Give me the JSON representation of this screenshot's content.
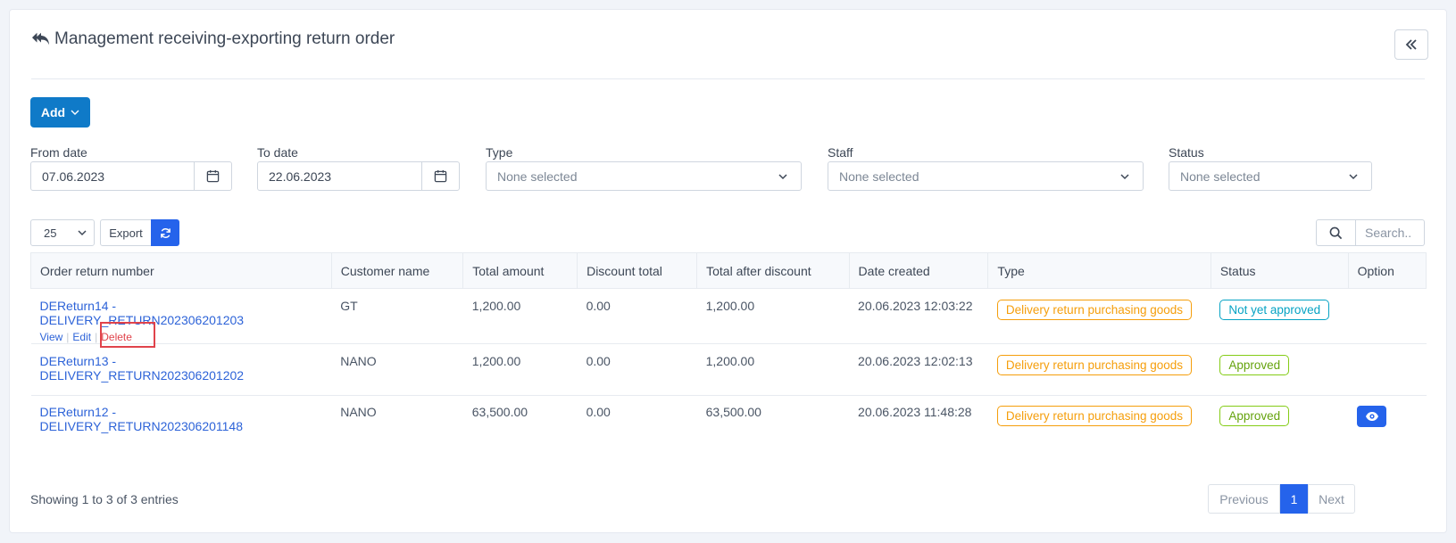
{
  "header": {
    "title": "Management receiving-exporting return order",
    "icon": "reply-all-icon"
  },
  "toolbar": {
    "add_label": "Add"
  },
  "filters": {
    "from_date": {
      "label": "From date",
      "value": "07.06.2023"
    },
    "to_date": {
      "label": "To date",
      "value": "22.06.2023"
    },
    "type": {
      "label": "Type",
      "value": "None selected"
    },
    "staff": {
      "label": "Staff",
      "value": "None selected"
    },
    "status": {
      "label": "Status",
      "value": "None selected"
    }
  },
  "table_controls": {
    "page_length": "25",
    "export_label": "Export",
    "search_placeholder": "Search.."
  },
  "table": {
    "columns": [
      "Order return number",
      "Customer name",
      "Total amount",
      "Discount total",
      "Total after discount",
      "Date created",
      "Type",
      "Status",
      "Option"
    ],
    "row_actions": {
      "view": "View",
      "edit": "Edit",
      "delete": "Delete"
    },
    "rows": [
      {
        "order": "DEReturn14 - DELIVERY_RETURN202306201203",
        "customer": "GT",
        "total": "1,200.00",
        "discount": "0.00",
        "after": "1,200.00",
        "date": "20.06.2023 12:03:22",
        "type": "Delivery return purchasing goods",
        "status": "Not yet approved"
      },
      {
        "order": "DEReturn13 - DELIVERY_RETURN202306201202",
        "customer": "NANO",
        "total": "1,200.00",
        "discount": "0.00",
        "after": "1,200.00",
        "date": "20.06.2023 12:02:13",
        "type": "Delivery return purchasing goods",
        "status": "Approved"
      },
      {
        "order": "DEReturn12 - DELIVERY_RETURN202306201148",
        "customer": "NANO",
        "total": "63,500.00",
        "discount": "0.00",
        "after": "63,500.00",
        "date": "20.06.2023 11:48:28",
        "type": "Delivery return purchasing goods",
        "status": "Approved"
      }
    ]
  },
  "footer": {
    "info": "Showing 1 to 3 of 3 entries",
    "previous": "Previous",
    "current_page": "1",
    "next": "Next"
  },
  "colors": {
    "primary": "#2563eb",
    "add": "#0f7ac8",
    "warning": "#f59e0b",
    "info": "#06a3c4",
    "success": "#84cc16",
    "danger": "#e0434b"
  }
}
